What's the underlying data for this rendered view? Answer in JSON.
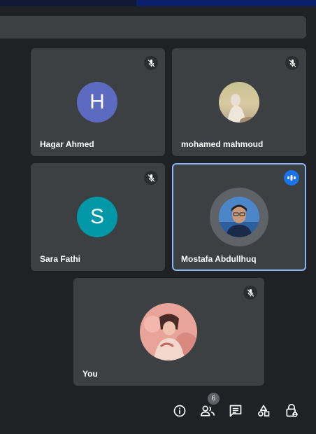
{
  "participants": [
    {
      "name": "Hagar Ahmed",
      "avatar_letter": "H",
      "avatar_color": "#5c6bc0",
      "muted": true
    },
    {
      "name": "mohamed mahmoud",
      "avatar_type": "photo",
      "muted": true
    },
    {
      "name": "Sara Fathi",
      "avatar_letter": "S",
      "avatar_color": "#0097a7",
      "muted": true
    },
    {
      "name": "Mostafa Abdullhuq",
      "avatar_type": "photo",
      "speaking": true,
      "highlight_color": "#8ab4f8"
    },
    {
      "name": "You",
      "avatar_type": "photo",
      "muted": true
    }
  ],
  "toolbar": {
    "people_count": "6",
    "icons": [
      "info-icon",
      "people-icon",
      "chat-icon",
      "activities-icon",
      "host-controls-icon"
    ]
  },
  "colors": {
    "background": "#202124",
    "tile": "#3c4043",
    "speaking": "#1a73e8"
  }
}
